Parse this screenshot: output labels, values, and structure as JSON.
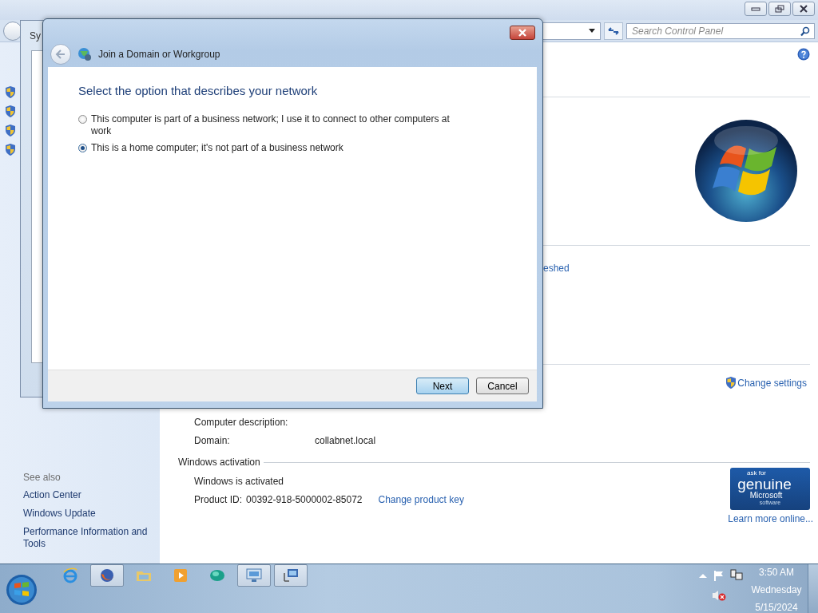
{
  "control_panel": {
    "search": {
      "placeholder": "Search Control Panel"
    },
    "sidebar": {
      "see_also": "See also",
      "links": [
        "Action Center",
        "Windows Update",
        "Performance Information and Tools"
      ]
    },
    "partial_text": "eshed",
    "change_settings": "Change settings",
    "computer_fields": [
      {
        "label": "Computer description:"
      },
      {
        "label": "Domain:",
        "value": "collabnet.local"
      }
    ],
    "activation": {
      "heading": "Windows activation",
      "status": "Windows is activated",
      "product_id_label": "Product ID:",
      "product_id": "00392-918-5000002-85072",
      "change_key": "Change product key",
      "badge": [
        "ask for",
        "genuine",
        "Microsoft",
        "software"
      ],
      "learn_more": "Learn more online..."
    }
  },
  "back_window": {
    "title": "Sy"
  },
  "dialog": {
    "title": "Join a Domain or Workgroup",
    "heading": "Select the option that describes your network",
    "options": [
      {
        "label": "This computer is part of a business network; I use it to connect to other computers at work",
        "selected": false
      },
      {
        "label": "This is a home computer; it's not part of a business network",
        "selected": true
      }
    ],
    "buttons": [
      {
        "label": "Next",
        "default": true
      },
      {
        "label": "Cancel",
        "default": false
      }
    ]
  },
  "taskbar": {
    "apps": [
      {
        "kind": "ie",
        "active": false
      },
      {
        "kind": "firefox",
        "active": true
      },
      {
        "kind": "folder",
        "active": false
      },
      {
        "kind": "media",
        "active": false
      },
      {
        "kind": "globe",
        "active": false
      },
      {
        "kind": "monitor",
        "active": true
      },
      {
        "kind": "network",
        "active": true
      }
    ],
    "clock": {
      "time": "3:50 AM",
      "day": "Wednesday",
      "date": "5/15/2024"
    }
  }
}
